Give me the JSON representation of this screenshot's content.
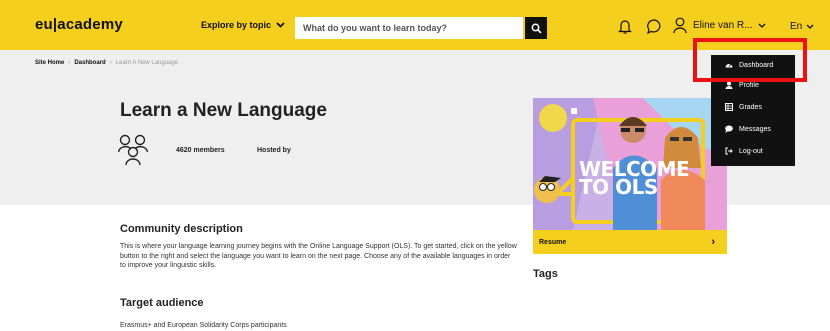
{
  "header": {
    "logo": "eu|academy",
    "explore_label": "Explore by topic",
    "search_placeholder": "What do you want to learn today?",
    "user_name": "Eline van R...",
    "language": "En",
    "accent_color": "#f5cf1d"
  },
  "breadcrumb": {
    "items": [
      "Site Home",
      "Dashboard",
      "Learn A New Language"
    ],
    "separator": "›"
  },
  "course": {
    "title": "Learn a New Language",
    "members": "4620 members",
    "hosted_by": "Hosted by"
  },
  "promo": {
    "welcome_text_line1": "WELCOME",
    "welcome_text_line2": "TO OLS",
    "resume_label": "Resume",
    "resume_arrow": "›"
  },
  "tags_heading": "Tags",
  "community": {
    "heading": "Community description",
    "text": "This is where your language learning journey begins with the Online Language Support (OLS). To get started, click on the yellow button to the right and select the language you want to learn on the next page. Choose any of the available languages in order to improve your linguistic skills."
  },
  "audience": {
    "heading": "Target audience",
    "text": "Erasmus+ and European Solidarity Corps participants"
  },
  "user_menu": {
    "items": [
      {
        "label": "Dashboard",
        "icon": "dashboard-icon"
      },
      {
        "label": "Profile",
        "icon": "profile-icon"
      },
      {
        "label": "Grades",
        "icon": "grades-icon"
      },
      {
        "label": "Messages",
        "icon": "messages-icon"
      },
      {
        "label": "Log-out",
        "icon": "logout-icon"
      }
    ],
    "highlight_color": "#ee1111"
  }
}
